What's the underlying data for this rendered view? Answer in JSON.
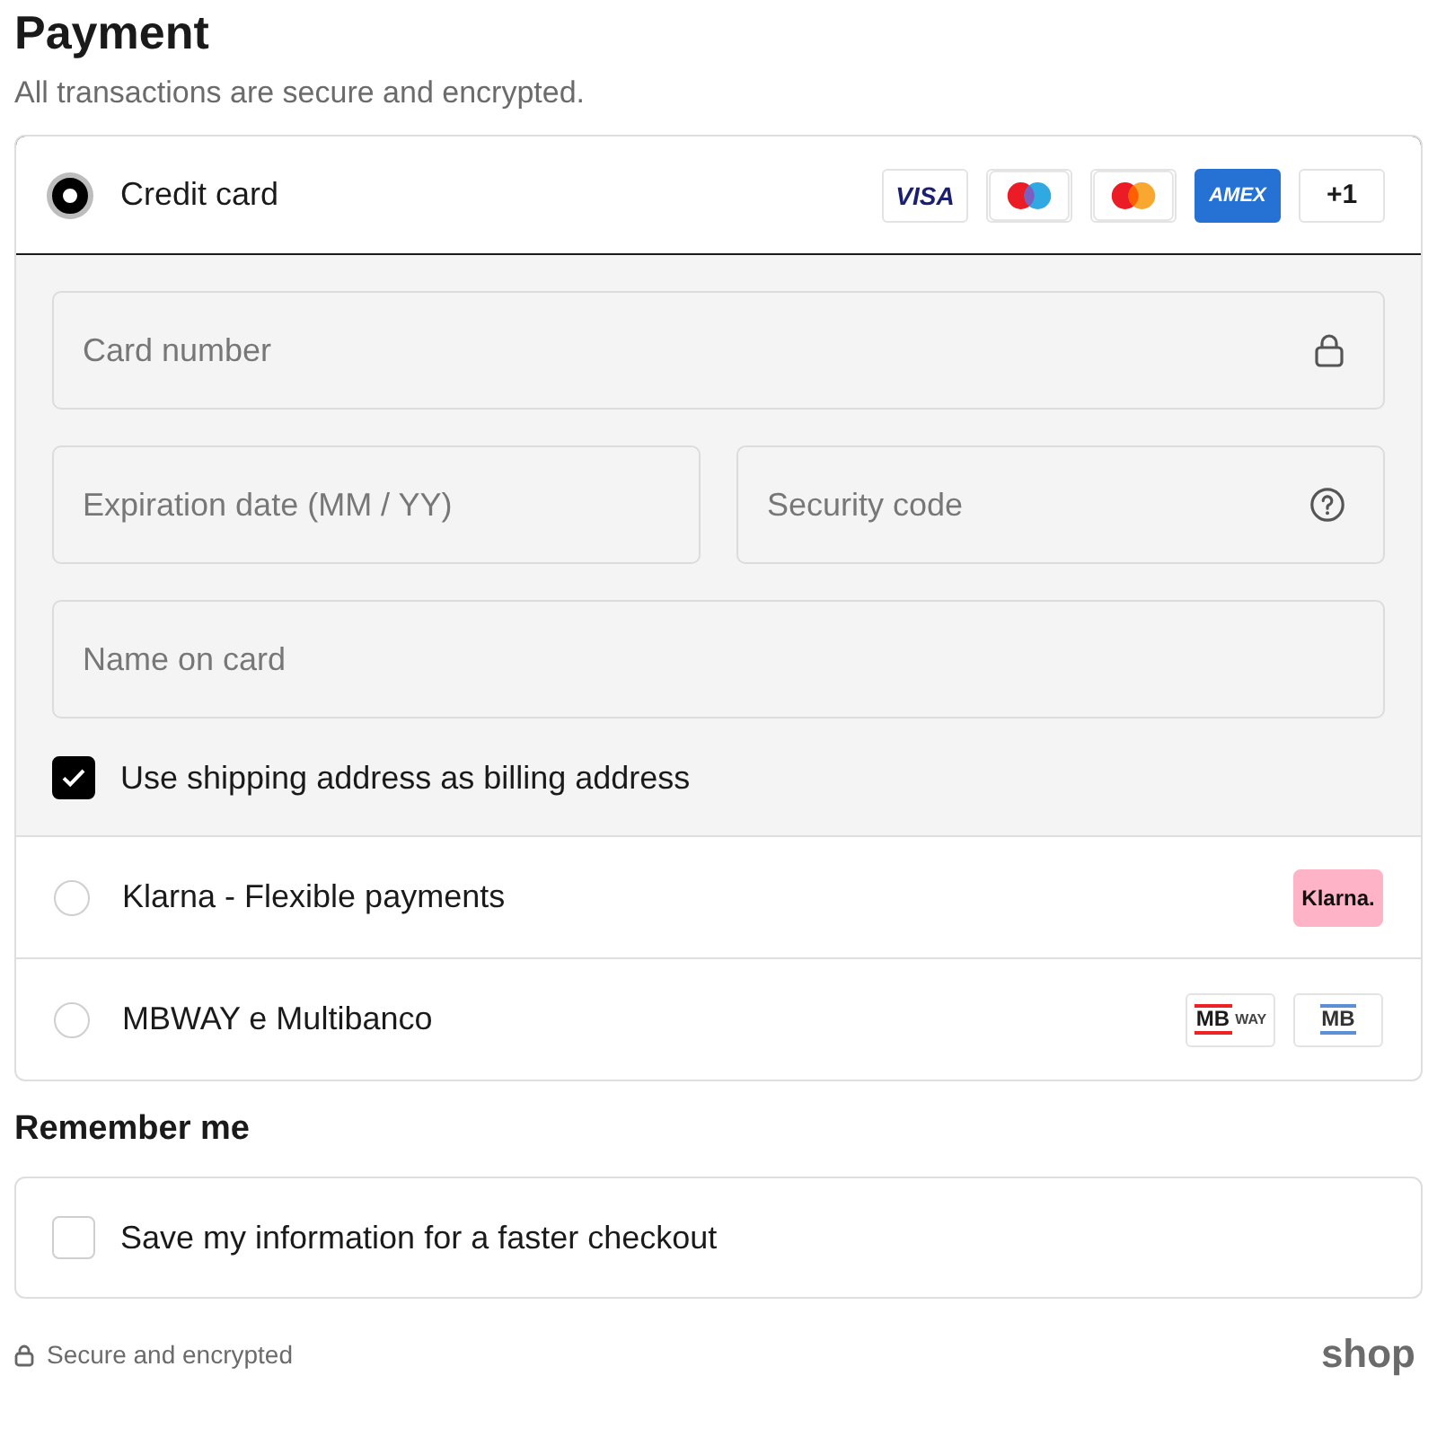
{
  "title": "Payment",
  "subtitle": "All transactions are secure and encrypted.",
  "methods": [
    {
      "label": "Credit card",
      "selected": true,
      "badges": [
        {
          "kind": "visa",
          "text": "VISA"
        },
        {
          "kind": "maestro"
        },
        {
          "kind": "mastercard"
        },
        {
          "kind": "amex",
          "text": "AMEX"
        },
        {
          "kind": "more",
          "text": "+1"
        }
      ],
      "form": {
        "rows": [
          [
            {
              "kind": "card_number",
              "placeholder": "Card number"
            }
          ],
          [
            {
              "kind": "expiry",
              "placeholder": "Expiration date (MM / YY)"
            },
            {
              "kind": "security",
              "placeholder": "Security code"
            }
          ],
          [
            {
              "kind": "name",
              "placeholder": "Name on card"
            }
          ]
        ],
        "billing": {
          "label": "Use shipping address as billing address",
          "checked": true
        }
      }
    },
    {
      "label": "Klarna - Flexible payments",
      "selected": false,
      "badges": [
        {
          "kind": "klarna",
          "text": "Klarna."
        }
      ]
    },
    {
      "label": "MBWAY e Multibanco",
      "selected": false,
      "badges": [
        {
          "kind": "mbway",
          "text": "MB",
          "text2": "WAY"
        },
        {
          "kind": "mb",
          "text": "MB"
        }
      ]
    }
  ],
  "remember": {
    "heading": "Remember me",
    "label": "Save my information for a faster checkout",
    "checked": false
  },
  "footer": {
    "text": "Secure and encrypted",
    "logo": "shop"
  }
}
